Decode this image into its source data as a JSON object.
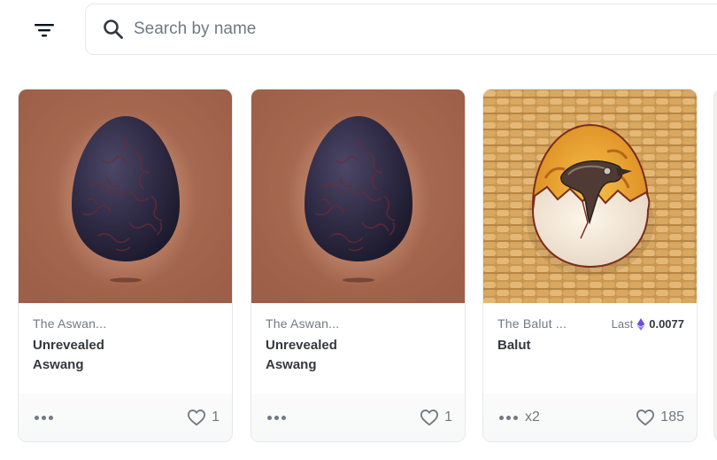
{
  "search": {
    "placeholder": "Search by name"
  },
  "icons": {
    "filter": "filter-lines-icon",
    "search": "magnifier-icon",
    "more": "ellipsis-icon",
    "like": "heart-outline-icon",
    "currency": "ethereum-icon"
  },
  "colors": {
    "egg_background": "#a5674e",
    "egg_shell": "#2b2940",
    "text_primary": "#353840",
    "text_secondary": "#707a83",
    "eth": "#6f4de0"
  },
  "cards": [
    {
      "collection": "The Aswan...",
      "name_line1": "Unrevealed",
      "name_line2": "Aswang",
      "likes": "1",
      "image": "dark-egg"
    },
    {
      "collection": "The Aswan...",
      "name_line1": "Unrevealed",
      "name_line2": "Aswang",
      "likes": "1",
      "image": "dark-egg"
    },
    {
      "collection": "The Balut ...",
      "name_line1": "Balut",
      "price_label": "Last",
      "price_value": "0.0077",
      "quantity": "x2",
      "likes": "185",
      "image": "balut-egg-on-woven-basket"
    }
  ]
}
